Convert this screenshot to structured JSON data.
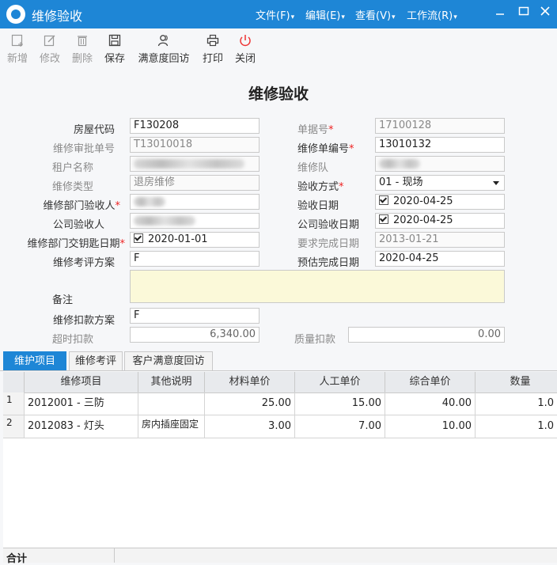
{
  "window": {
    "title": "维修验收"
  },
  "menu": [
    {
      "label": "文件(F)"
    },
    {
      "label": "编辑(E)"
    },
    {
      "label": "查看(V)"
    },
    {
      "label": "工作流(R)"
    }
  ],
  "toolbar": {
    "new": "新增",
    "edit": "修改",
    "delete": "删除",
    "save": "保存",
    "satisfaction": "满意度回访",
    "print": "打印",
    "close": "关闭"
  },
  "form": {
    "title": "维修验收",
    "house_code": {
      "label": "房屋代码",
      "value": "F130208"
    },
    "doc_no": {
      "label": "单据号",
      "value": "17100128"
    },
    "approval_no": {
      "label": "维修审批单号",
      "value": "T13010018"
    },
    "repair_no": {
      "label": "维修单编号",
      "value": "13010132"
    },
    "tenant": {
      "label": "租户名称"
    },
    "team": {
      "label": "维修队"
    },
    "repair_type": {
      "label": "维修类型",
      "value": "退房维修"
    },
    "accept_method": {
      "label": "验收方式",
      "value": "01 - 现场"
    },
    "dept_acceptor": {
      "label": "维修部门验收人"
    },
    "accept_date": {
      "label": "验收日期",
      "value": "2020-04-25"
    },
    "company_acceptor": {
      "label": "公司验收人"
    },
    "company_accept_date": {
      "label": "公司验收日期",
      "value": "2020-04-25"
    },
    "key_handover_date": {
      "label": "维修部门交钥匙日期",
      "value": "2020-01-01"
    },
    "required_finish_date": {
      "label": "要求完成日期",
      "value": "2013-01-21"
    },
    "evaluation_plan": {
      "label": "维修考评方案",
      "value": "F"
    },
    "estimated_finish_date": {
      "label": "预估完成日期",
      "value": "2020-04-25"
    },
    "remark": {
      "label": "备注",
      "value": ""
    },
    "deduction_plan": {
      "label": "维修扣款方案",
      "value": "F"
    },
    "overtime_deduction": {
      "label": "超时扣款",
      "value": "6,340.00"
    },
    "quality_deduction": {
      "label": "质量扣款",
      "value": "0.00"
    }
  },
  "tabs": [
    {
      "label": "维护项目"
    },
    {
      "label": "维修考评"
    },
    {
      "label": "客户满意度回访"
    }
  ],
  "grid": {
    "columns": [
      "维修项目",
      "其他说明",
      "材料单价",
      "人工单价",
      "综合单价",
      "数量"
    ],
    "rows": [
      {
        "no": "1",
        "item": "2012001 - 三防",
        "note": "",
        "material": "25.00",
        "labor": "15.00",
        "total": "40.00",
        "qty": "1.0"
      },
      {
        "no": "2",
        "item": "2012083 - 灯头",
        "note": "房内插座固定",
        "material": "3.00",
        "labor": "7.00",
        "total": "10.00",
        "qty": "1.0"
      }
    ],
    "footer_label": "合计"
  },
  "colors": {
    "accent": "#1e86d6",
    "required": "#e22222",
    "remark_bg": "#fbf9d9"
  }
}
